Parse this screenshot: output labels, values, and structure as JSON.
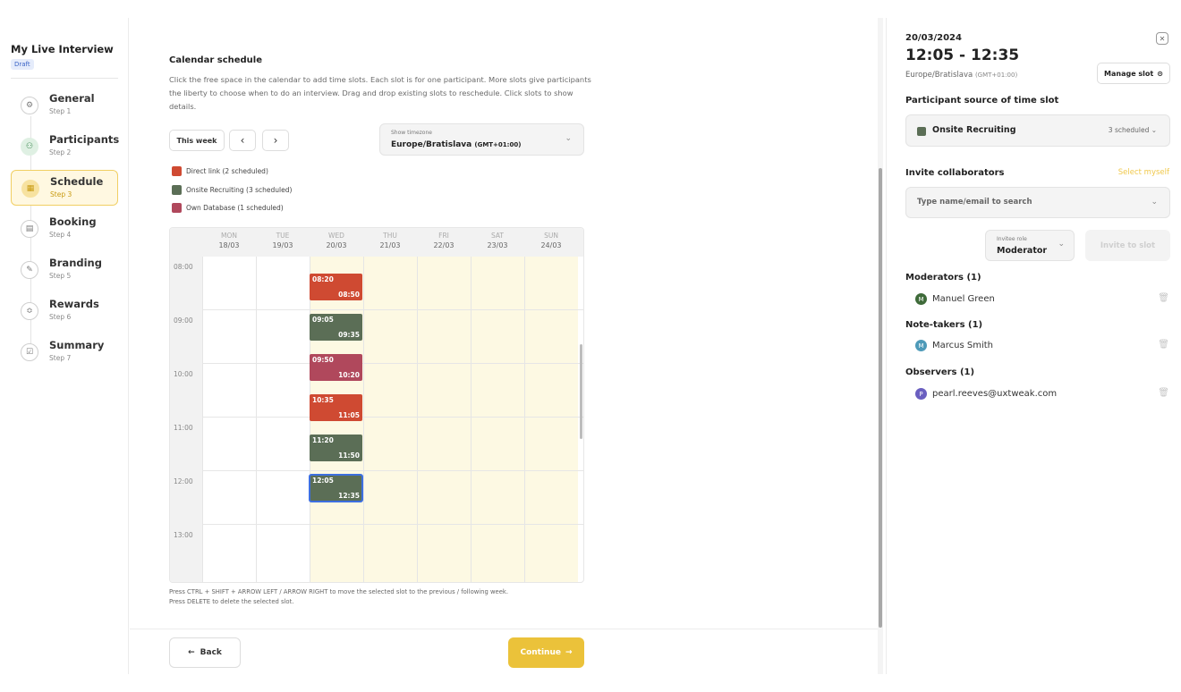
{
  "sidebar": {
    "title": "My Live Interview",
    "badge": "Draft",
    "steps": [
      {
        "name": "General",
        "sub": "Step 1",
        "icon": "⚙"
      },
      {
        "name": "Participants",
        "sub": "Step 2",
        "icon": "⚇"
      },
      {
        "name": "Schedule",
        "sub": "Step 3",
        "icon": "▦"
      },
      {
        "name": "Booking",
        "sub": "Step 4",
        "icon": "▤"
      },
      {
        "name": "Branding",
        "sub": "Step 5",
        "icon": "✎"
      },
      {
        "name": "Rewards",
        "sub": "Step 6",
        "icon": "≎"
      },
      {
        "name": "Summary",
        "sub": "Step 7",
        "icon": "☑"
      }
    ]
  },
  "main": {
    "title": "Calendar schedule",
    "description": "Click the free space in the calendar to add time slots. Each slot is for one participant. More slots give participants the liberty to choose when to do an interview. Drag and drop existing slots to reschedule. Click slots to show details.",
    "this_week": "This week",
    "prev_icon": "‹",
    "next_icon": "›",
    "timezone": {
      "label": "Show timezone",
      "value": "Europe/Bratislava",
      "offset": "(GMT+01:00)"
    },
    "legend": [
      {
        "label": "Direct link  (2 scheduled)",
        "color": "#cf4a32"
      },
      {
        "label": "Onsite Recruiting  (3 scheduled)",
        "color": "#5b6e56"
      },
      {
        "label": "Own Database  (1 scheduled)",
        "color": "#b0485c"
      }
    ],
    "days": [
      {
        "name": "MON",
        "date": "18/03"
      },
      {
        "name": "TUE",
        "date": "19/03"
      },
      {
        "name": "WED",
        "date": "20/03"
      },
      {
        "name": "THU",
        "date": "21/03"
      },
      {
        "name": "FRI",
        "date": "22/03"
      },
      {
        "name": "SAT",
        "date": "23/03"
      },
      {
        "name": "SUN",
        "date": "24/03"
      }
    ],
    "hours": [
      "08:00",
      "09:00",
      "10:00",
      "11:00",
      "12:00",
      "13:00"
    ],
    "slots": [
      {
        "start": "08:20",
        "end": "08:50",
        "color": "#cf4a32"
      },
      {
        "start": "09:05",
        "end": "09:35",
        "color": "#5b6e56"
      },
      {
        "start": "09:50",
        "end": "10:20",
        "color": "#b0485c"
      },
      {
        "start": "10:35",
        "end": "11:05",
        "color": "#cf4a32"
      },
      {
        "start": "11:20",
        "end": "11:50",
        "color": "#5b6e56"
      },
      {
        "start": "12:05",
        "end": "12:35",
        "color": "#5b6e56"
      }
    ],
    "hint_line1": "Press CTRL + SHIFT + ARROW LEFT / ARROW RIGHT to move the selected slot to the previous / following week.",
    "hint_line2": "Press DELETE to delete the selected slot.",
    "back_label": "Back",
    "continue_label": "Continue"
  },
  "panel": {
    "date": "20/03/2024",
    "time": "12:05 - 12:35",
    "timezone": "Europe/Bratislava",
    "tz_offset": "(GMT+01:00)",
    "manage_label": "Manage slot",
    "source_heading": "Participant source of time slot",
    "source_name": "Onsite Recruiting",
    "source_count": "3 scheduled",
    "source_color": "#5b6e56",
    "invite_heading": "Invite collaborators",
    "select_myself": "Select myself",
    "search_placeholder": "Type name/email to search",
    "role_label": "Invitee role",
    "role_value": "Moderator",
    "invite_button": "Invite to slot",
    "groups": [
      {
        "title": "Moderators (1)",
        "person": "Manuel Green",
        "initial": "M",
        "color": "#3f6b3a"
      },
      {
        "title": "Note-takers (1)",
        "person": "Marcus Smith",
        "initial": "M",
        "color": "#4e9ab8"
      },
      {
        "title": "Observers (1)",
        "person": "pearl.reeves@uxtweak.com",
        "initial": "P",
        "color": "#6a5fc0"
      }
    ]
  }
}
